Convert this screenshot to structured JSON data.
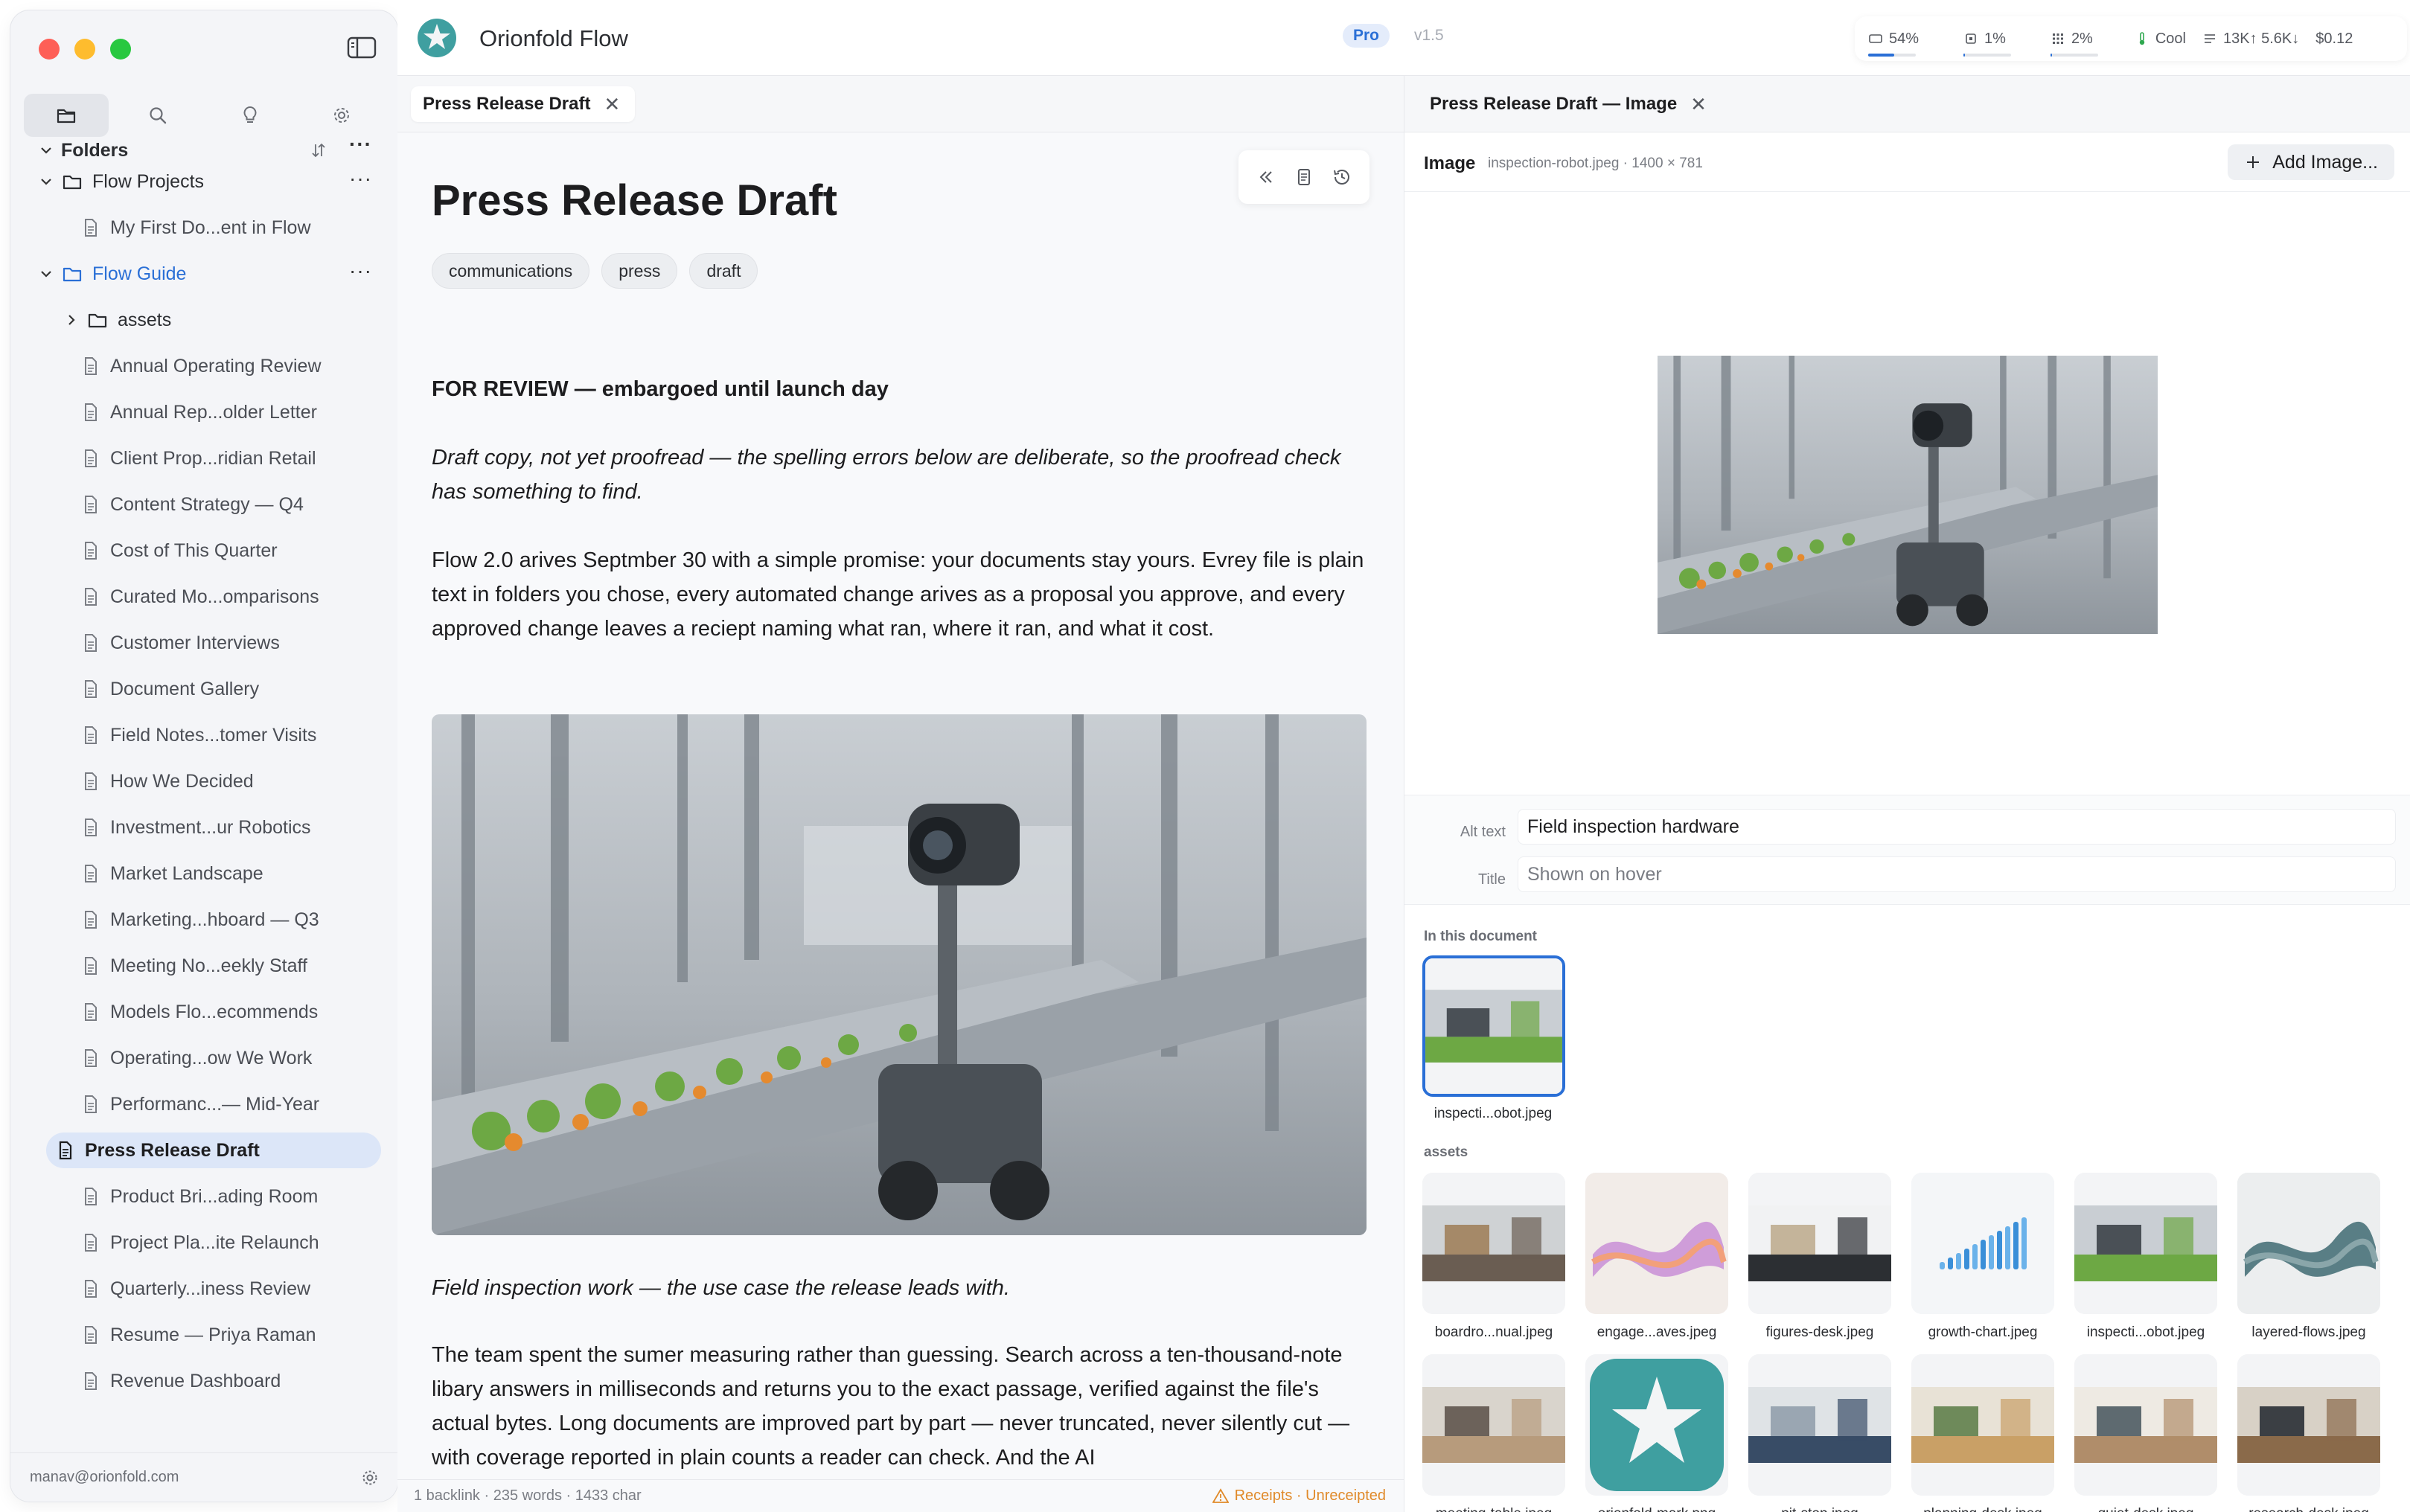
{
  "window": {
    "app_title": "Orionfold Flow",
    "plan_badge": "Pro",
    "version": "v1.5"
  },
  "stats": {
    "context_label": "54%",
    "context_fraction": 0.54,
    "cpu_label": "1%",
    "cpu_fraction": 0.01,
    "memory_label": "2%",
    "memory_fraction": 0.02,
    "thermal": "Cool",
    "tokens": "13K↑ 5.6K↓",
    "cost": "$0.12"
  },
  "sidebar": {
    "section_title": "Folders",
    "tree": [
      {
        "label": "Flow Projects",
        "type": "folder",
        "expanded": true,
        "level": 0
      },
      {
        "label": "My First Do...ent in Flow",
        "type": "file",
        "level": 1
      },
      {
        "label": "Flow Guide",
        "type": "folder",
        "expanded": true,
        "level": 0,
        "accent": true
      },
      {
        "label": "assets",
        "type": "folder",
        "expanded": false,
        "level": 1
      },
      {
        "label": "Annual Operating Review",
        "type": "file",
        "level": 1
      },
      {
        "label": "Annual Rep...older Letter",
        "type": "file",
        "level": 1
      },
      {
        "label": "Client Prop...ridian Retail",
        "type": "file",
        "level": 1
      },
      {
        "label": "Content Strategy — Q4",
        "type": "file",
        "level": 1
      },
      {
        "label": "Cost of This Quarter",
        "type": "file",
        "level": 1
      },
      {
        "label": "Curated Mo...omparisons",
        "type": "file",
        "level": 1
      },
      {
        "label": "Customer Interviews",
        "type": "file",
        "level": 1
      },
      {
        "label": "Document Gallery",
        "type": "file",
        "level": 1
      },
      {
        "label": "Field Notes...tomer Visits",
        "type": "file",
        "level": 1
      },
      {
        "label": "How We Decided",
        "type": "file",
        "level": 1
      },
      {
        "label": "Investment...ur Robotics",
        "type": "file",
        "level": 1
      },
      {
        "label": "Market Landscape",
        "type": "file",
        "level": 1
      },
      {
        "label": "Marketing...hboard — Q3",
        "type": "file",
        "level": 1
      },
      {
        "label": "Meeting No...eekly Staff",
        "type": "file",
        "level": 1
      },
      {
        "label": "Models Flo...ecommends",
        "type": "file",
        "level": 1
      },
      {
        "label": "Operating...ow We Work",
        "type": "file",
        "level": 1
      },
      {
        "label": "Performanc...— Mid-Year",
        "type": "file",
        "level": 1
      },
      {
        "label": "Press Release Draft",
        "type": "file",
        "level": 1,
        "selected": true
      },
      {
        "label": "Product Bri...ading Room",
        "type": "file",
        "level": 1
      },
      {
        "label": "Project Pla...ite Relaunch",
        "type": "file",
        "level": 1
      },
      {
        "label": "Quarterly...iness Review",
        "type": "file",
        "level": 1
      },
      {
        "label": "Resume — Priya Raman",
        "type": "file",
        "level": 1
      },
      {
        "label": "Revenue Dashboard",
        "type": "file",
        "level": 1
      }
    ],
    "account": "manav@orionfold.com"
  },
  "editor": {
    "tab_label": "Press Release Draft",
    "title": "Press Release Draft",
    "tags": [
      "communications",
      "press",
      "draft"
    ],
    "review_line": "FOR REVIEW — embargoed until launch day",
    "note": "Draft copy, not yet proofread — the spelling errors below are deliberate, so the proofread check has something to find.",
    "para1": "Flow 2.0 arives Septmber 30 with a simple promise: your documents stay yours. Evrey file is plain text in folders you chose, every automated change arives as a proposal you approve, and every approved change leaves a reciept naming what ran, where it ran, and what it cost.",
    "caption": "Field inspection work — the use case the release leads with.",
    "para2": "The team spent the sumer measuring rather than guessing. Search across a ten-thousand-note libary answers in milliseconds and returns you to the exact passage, verified against the file's actual bytes. Long documents are improved part by part — never truncated, never silently cut — with coverage reported in plain counts a reader can check. And the AI",
    "status_left": "1 backlink · 235 words · 1433 char",
    "receipts": "Receipts · Unreceipted"
  },
  "image_panel": {
    "tab_label": "Press Release Draft — Image",
    "label": "Image",
    "meta": "inspection-robot.jpeg · 1400 × 781",
    "add_button": "Add Image...",
    "alt_label": "Alt text",
    "alt_value": "Field inspection hardware",
    "title_label": "Title",
    "title_placeholder": "Shown on hover",
    "in_doc_label": "In this document",
    "in_doc": [
      {
        "name": "inspecti...obot.jpeg"
      }
    ],
    "assets_label": "assets",
    "assets": [
      {
        "name": "boardro...nual.jpeg"
      },
      {
        "name": "engage...aves.jpeg"
      },
      {
        "name": "figures-desk.jpeg"
      },
      {
        "name": "growth-chart.jpeg"
      },
      {
        "name": "inspecti...obot.jpeg"
      },
      {
        "name": "layered-flows.jpeg"
      },
      {
        "name": "meeting-table.jpeg"
      },
      {
        "name": "orionfold-mark.png"
      },
      {
        "name": "pit-stop.jpeg"
      },
      {
        "name": "planning-desk.jpeg"
      },
      {
        "name": "quiet-desk.jpeg"
      },
      {
        "name": "research-desk.jpeg"
      }
    ]
  },
  "colors": {
    "accent": "#2a6fd6",
    "selected_bg": "#dce6f8",
    "warning": "#e08a2a"
  }
}
